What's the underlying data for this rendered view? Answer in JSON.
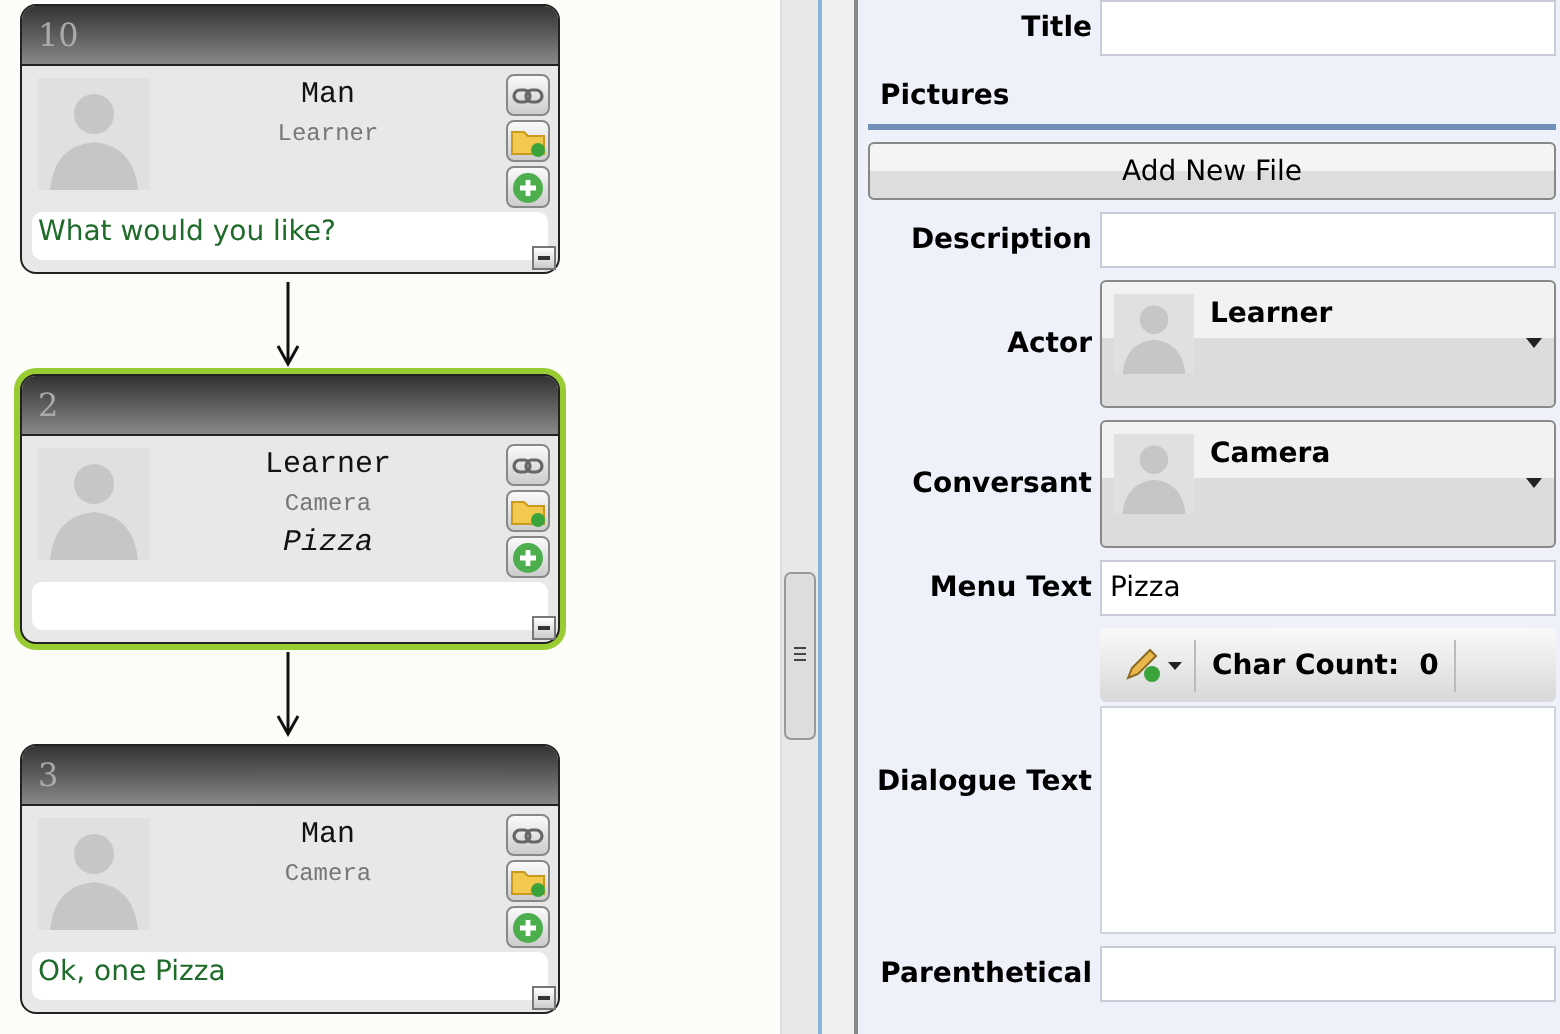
{
  "nodes": [
    {
      "number": "10",
      "selected": false,
      "speaker": "Man",
      "listener": "Learner",
      "dialogue": "What would you like?"
    },
    {
      "number": "2",
      "selected": true,
      "speaker": "Learner",
      "listener": "Camera",
      "menu_text": "Pizza"
    },
    {
      "number": "3",
      "selected": false,
      "speaker": "Man",
      "listener": "Camera",
      "dialogue": "Ok, one Pizza"
    }
  ],
  "form": {
    "rows": [
      {
        "kind": "text",
        "label": "Title"
      },
      {
        "kind": "heading",
        "label": "Pictures"
      },
      {
        "kind": "button",
        "label": "Add New File"
      },
      {
        "kind": "text",
        "label": "Description"
      },
      {
        "kind": "combo",
        "label": "Actor",
        "value": "Learner"
      },
      {
        "kind": "combo",
        "label": "Conversant",
        "value": "Camera"
      },
      {
        "kind": "text",
        "label": "Menu Text",
        "value": "Pizza"
      },
      {
        "kind": "editor",
        "label": "Dialogue Text",
        "count_label": "Char Count:",
        "count": "0"
      },
      {
        "kind": "text",
        "label": "Parenthetical"
      }
    ]
  }
}
